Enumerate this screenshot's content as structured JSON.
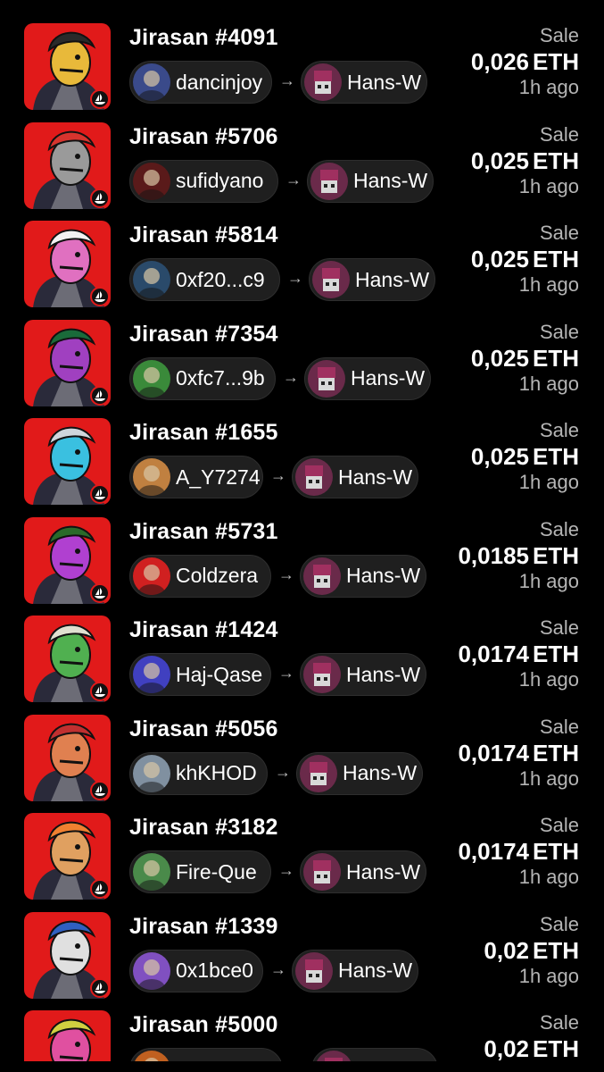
{
  "sales": [
    {
      "title": "Jirasan #4091",
      "from": "dancinjoy",
      "to": "Hans-W",
      "type": "Sale",
      "price": "0,026",
      "currency": "ETH",
      "time": "1h ago",
      "colors": {
        "skin": "#e8b93a",
        "hair": "#2a2a2a",
        "from_avatar": "#3a4a8a"
      }
    },
    {
      "title": "Jirasan #5706",
      "from": "sufidyano",
      "to": "Hans-W",
      "type": "Sale",
      "price": "0,025",
      "currency": "ETH",
      "time": "1h ago",
      "colors": {
        "skin": "#9a9a9a",
        "hair": "#d6342e",
        "from_avatar": "#5a1a1a"
      }
    },
    {
      "title": "Jirasan #5814",
      "from": "0xf20...c9",
      "to": "Hans-W",
      "type": "Sale",
      "price": "0,025",
      "currency": "ETH",
      "time": "1h ago",
      "colors": {
        "skin": "#e070c0",
        "hair": "#f2f2f2",
        "from_avatar": "#2a4a6a"
      }
    },
    {
      "title": "Jirasan #7354",
      "from": "0xfc7...9b",
      "to": "Hans-W",
      "type": "Sale",
      "price": "0,025",
      "currency": "ETH",
      "time": "1h ago",
      "colors": {
        "skin": "#a040c0",
        "hair": "#1a6a3a",
        "from_avatar": "#3a8a3a"
      }
    },
    {
      "title": "Jirasan #1655",
      "from": "A_Y7274",
      "to": "Hans-W",
      "type": "Sale",
      "price": "0,025",
      "currency": "ETH",
      "time": "1h ago",
      "colors": {
        "skin": "#3ac0e0",
        "hair": "#cfd6dc",
        "from_avatar": "#c08040"
      }
    },
    {
      "title": "Jirasan #5731",
      "from": "Coldzera",
      "to": "Hans-W",
      "type": "Sale",
      "price": "0,0185",
      "currency": "ETH",
      "time": "1h ago",
      "colors": {
        "skin": "#b040d0",
        "hair": "#2a6a2a",
        "from_avatar": "#d02020"
      }
    },
    {
      "title": "Jirasan #1424",
      "from": "Haj-Qase",
      "to": "Hans-W",
      "type": "Sale",
      "price": "0,0174",
      "currency": "ETH",
      "time": "1h ago",
      "colors": {
        "skin": "#50b050",
        "hair": "#e0e0d0",
        "from_avatar": "#4040c0"
      }
    },
    {
      "title": "Jirasan #5056",
      "from": "khKHOD",
      "to": "Hans-W",
      "type": "Sale",
      "price": "0,0174",
      "currency": "ETH",
      "time": "1h ago",
      "colors": {
        "skin": "#e08050",
        "hair": "#c03030",
        "from_avatar": "#8090a0"
      }
    },
    {
      "title": "Jirasan #3182",
      "from": "Fire-Que",
      "to": "Hans-W",
      "type": "Sale",
      "price": "0,0174",
      "currency": "ETH",
      "time": "1h ago",
      "colors": {
        "skin": "#e0a060",
        "hair": "#f08030",
        "from_avatar": "#4a8a4a"
      }
    },
    {
      "title": "Jirasan #1339",
      "from": "0x1bce0",
      "to": "Hans-W",
      "type": "Sale",
      "price": "0,02",
      "currency": "ETH",
      "time": "1h ago",
      "colors": {
        "skin": "#e0e0e0",
        "hair": "#3060c0",
        "from_avatar": "#8050c0"
      }
    },
    {
      "title": "Jirasan #5000",
      "from": "",
      "to": "",
      "type": "Sale",
      "price": "0,02",
      "currency": "ETH",
      "time": "",
      "colors": {
        "skin": "#e050a0",
        "hair": "#d0d040",
        "from_avatar": "#c06020"
      }
    }
  ],
  "icons": {
    "marketplace_badge": "opensea-icon",
    "arrow": "arrow-right-icon"
  },
  "theme": {
    "background": "#000000",
    "card_red": "#e11a1a",
    "chip_bg": "#1f1f1f",
    "to_avatar": "#6a2a4a"
  }
}
